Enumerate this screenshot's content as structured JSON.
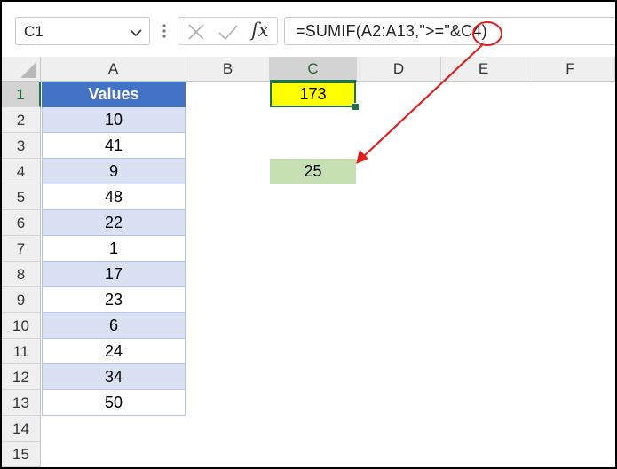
{
  "name_box": {
    "value": "C1"
  },
  "formula_bar": {
    "fx_label": "fx",
    "formula": "=SUMIF(A2:A13,\">=\"&C4)"
  },
  "columns": [
    "A",
    "B",
    "C",
    "D",
    "E",
    "F"
  ],
  "selected_column": "C",
  "rows": [
    "1",
    "2",
    "3",
    "4",
    "5",
    "6",
    "7",
    "8",
    "9",
    "10",
    "11",
    "12",
    "13",
    "14",
    "15"
  ],
  "selected_row": "1",
  "sheet": {
    "header": "Values",
    "values": [
      "10",
      "41",
      "9",
      "48",
      "22",
      "1",
      "17",
      "23",
      "6",
      "24",
      "34",
      "50"
    ],
    "c1": "173",
    "c4": "25"
  },
  "colors": {
    "header_fill": "#4472c4",
    "band_fill": "#d9e1f2",
    "c1_fill": "#ffff00",
    "c4_fill": "#c6e0b4",
    "annotation": "#e02020",
    "selection": "#217346"
  },
  "icons": [
    "chevron-down-icon",
    "more-dots-icon",
    "cancel-icon",
    "enter-icon",
    "function-icon"
  ]
}
